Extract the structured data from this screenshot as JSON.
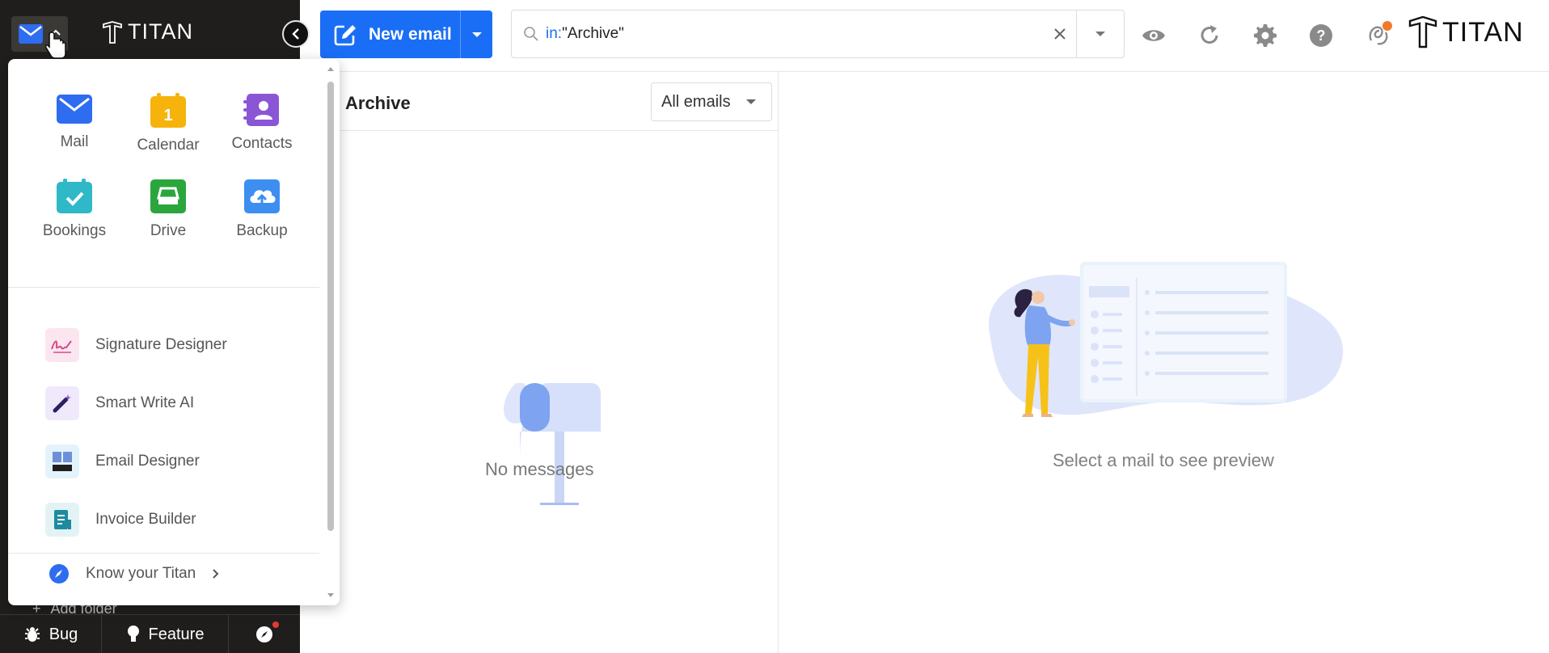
{
  "sidebar": {
    "brand": "TITAN",
    "add_folder": "Add folder",
    "bottom": {
      "bug": "Bug",
      "feature": "Feature"
    }
  },
  "apps_panel": {
    "apps": [
      {
        "label": "Mail",
        "icon": "mail-icon",
        "color": "#2e6cf0"
      },
      {
        "label": "Calendar",
        "icon": "calendar-icon",
        "color": "#f6b30c"
      },
      {
        "label": "Contacts",
        "icon": "contacts-icon",
        "color": "#8a56d6"
      },
      {
        "label": "Bookings",
        "icon": "bookings-icon",
        "color": "#2fb8c7"
      },
      {
        "label": "Drive",
        "icon": "drive-icon",
        "color": "#2aa63d"
      },
      {
        "label": "Backup",
        "icon": "backup-icon",
        "color": "#3c8ff0"
      }
    ],
    "calendar_day": "1",
    "tools": [
      {
        "label": "Signature Designer",
        "icon": "signature-icon"
      },
      {
        "label": "Smart Write AI",
        "icon": "smart-write-icon"
      },
      {
        "label": "Email Designer",
        "icon": "email-designer-icon"
      },
      {
        "label": "Invoice Builder",
        "icon": "invoice-icon"
      }
    ],
    "know_titan": "Know your Titan"
  },
  "toolbar": {
    "new_email": "New email",
    "search_keyword": "in:",
    "search_value": "\"Archive\"",
    "brand": "TITAN",
    "accent": "#1a6ef5",
    "notification_dot": "#f07a2a"
  },
  "list": {
    "folder": "Archive",
    "filter": "All emails",
    "empty": "No messages"
  },
  "preview": {
    "empty": "Select a mail to see preview"
  }
}
